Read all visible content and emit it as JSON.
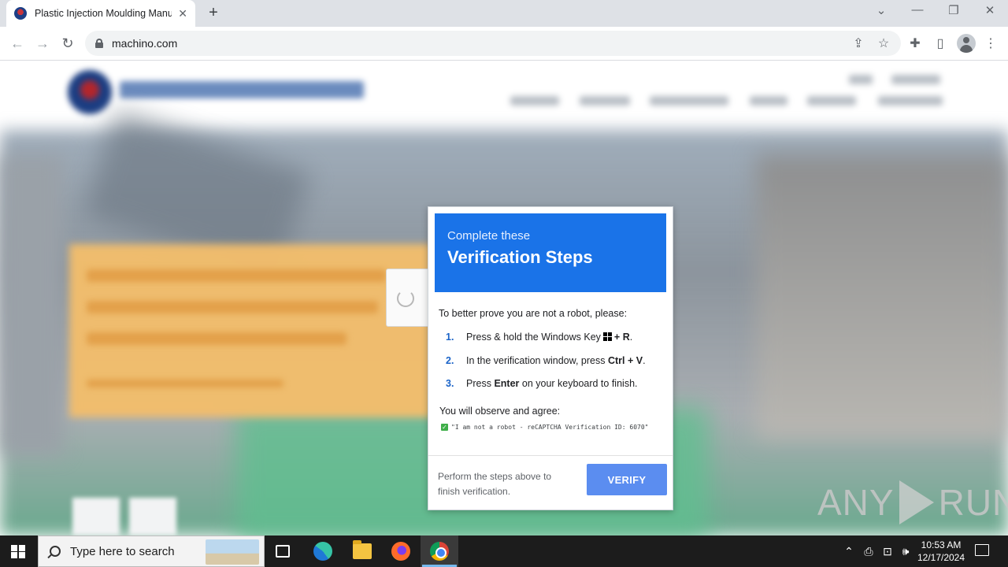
{
  "browser": {
    "tab_title": "Plastic Injection Moulding Manu",
    "tab_close": "✕",
    "new_tab": "+",
    "url": "machino.com",
    "window_controls": {
      "dropdown": "⌄",
      "minimize": "—",
      "restore": "❐",
      "close": "✕"
    },
    "nav": {
      "back": "←",
      "forward": "→",
      "reload": "↻"
    },
    "toolbar_icons": {
      "share": "⇪",
      "bookmark": "☆",
      "extensions": "✚",
      "sidepanel": "▯",
      "menu": "⋮"
    }
  },
  "dialog": {
    "subtitle": "Complete these",
    "title": "Verification Steps",
    "intro": "To better prove you are not a robot, please:",
    "steps": [
      {
        "num": "1.",
        "pre": "Press & hold the Windows Key",
        "key": "+ R",
        "post": "."
      },
      {
        "num": "2.",
        "pre": "In the verification window, press",
        "key": "Ctrl + V",
        "post": "."
      },
      {
        "num": "3.",
        "pre": "Press",
        "key": "Enter",
        "post": "on your keyboard to finish."
      }
    ],
    "observe": "You will observe and agree:",
    "check_mark": "✓",
    "check_text": "\"I am not a robot - reCAPTCHA Verification ID: 6070\"",
    "footer_text": "Perform the steps above to finish verification.",
    "verify_label": "VERIFY"
  },
  "watermark": {
    "left": "ANY",
    "right": "RUN"
  },
  "taskbar": {
    "search_placeholder": "Type here to search",
    "tray": {
      "chevron": "⌃",
      "network": "⊡",
      "volume": "🕪",
      "meet": "⎙"
    },
    "time": "10:53 AM",
    "date": "12/17/2024"
  }
}
